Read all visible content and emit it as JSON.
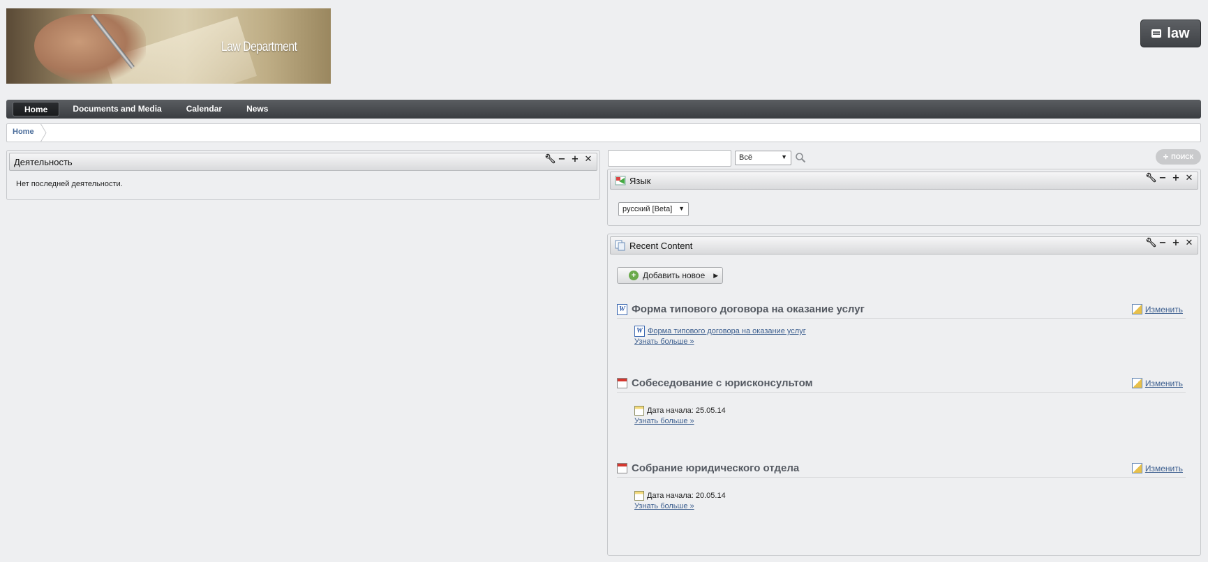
{
  "header": {
    "banner_title": "Law Department",
    "site_button_label": "law",
    "site_button_icon": "site-list-icon"
  },
  "nav": {
    "items": [
      {
        "label": "Home",
        "active": true
      },
      {
        "label": "Documents and Media",
        "active": false
      },
      {
        "label": "Calendar",
        "active": false
      },
      {
        "label": "News",
        "active": false
      }
    ]
  },
  "breadcrumb": {
    "items": [
      "Home"
    ]
  },
  "activity": {
    "title": "Деятельность",
    "message": "Нет последней деятельности."
  },
  "search": {
    "input_value": "",
    "scope_selected": "Всё",
    "button_label": "ПОИСК"
  },
  "language": {
    "title": "Язык",
    "selected": "русский [Beta]"
  },
  "recent_content": {
    "title": "Recent Content",
    "add_label": "Добавить новое",
    "edit_label": "Изменить",
    "more_label": "Узнать больше »",
    "entries": [
      {
        "title": "Форма типового договора на оказание услуг",
        "icon": "word-document-icon",
        "link": "Форма типового договора на оказание услуг"
      },
      {
        "title": "Собеседование с юрисконсультом",
        "icon": "calendar-icon",
        "date_label": "Дата начала: 25.05.14"
      },
      {
        "title": "Собрание юридического отдела",
        "icon": "calendar-icon",
        "date_label": "Дата начала: 20.05.14"
      }
    ]
  },
  "colors": {
    "nav_bg": "#4a4d51",
    "link": "#3d5f8f",
    "page_bg": "#eeeff1"
  }
}
